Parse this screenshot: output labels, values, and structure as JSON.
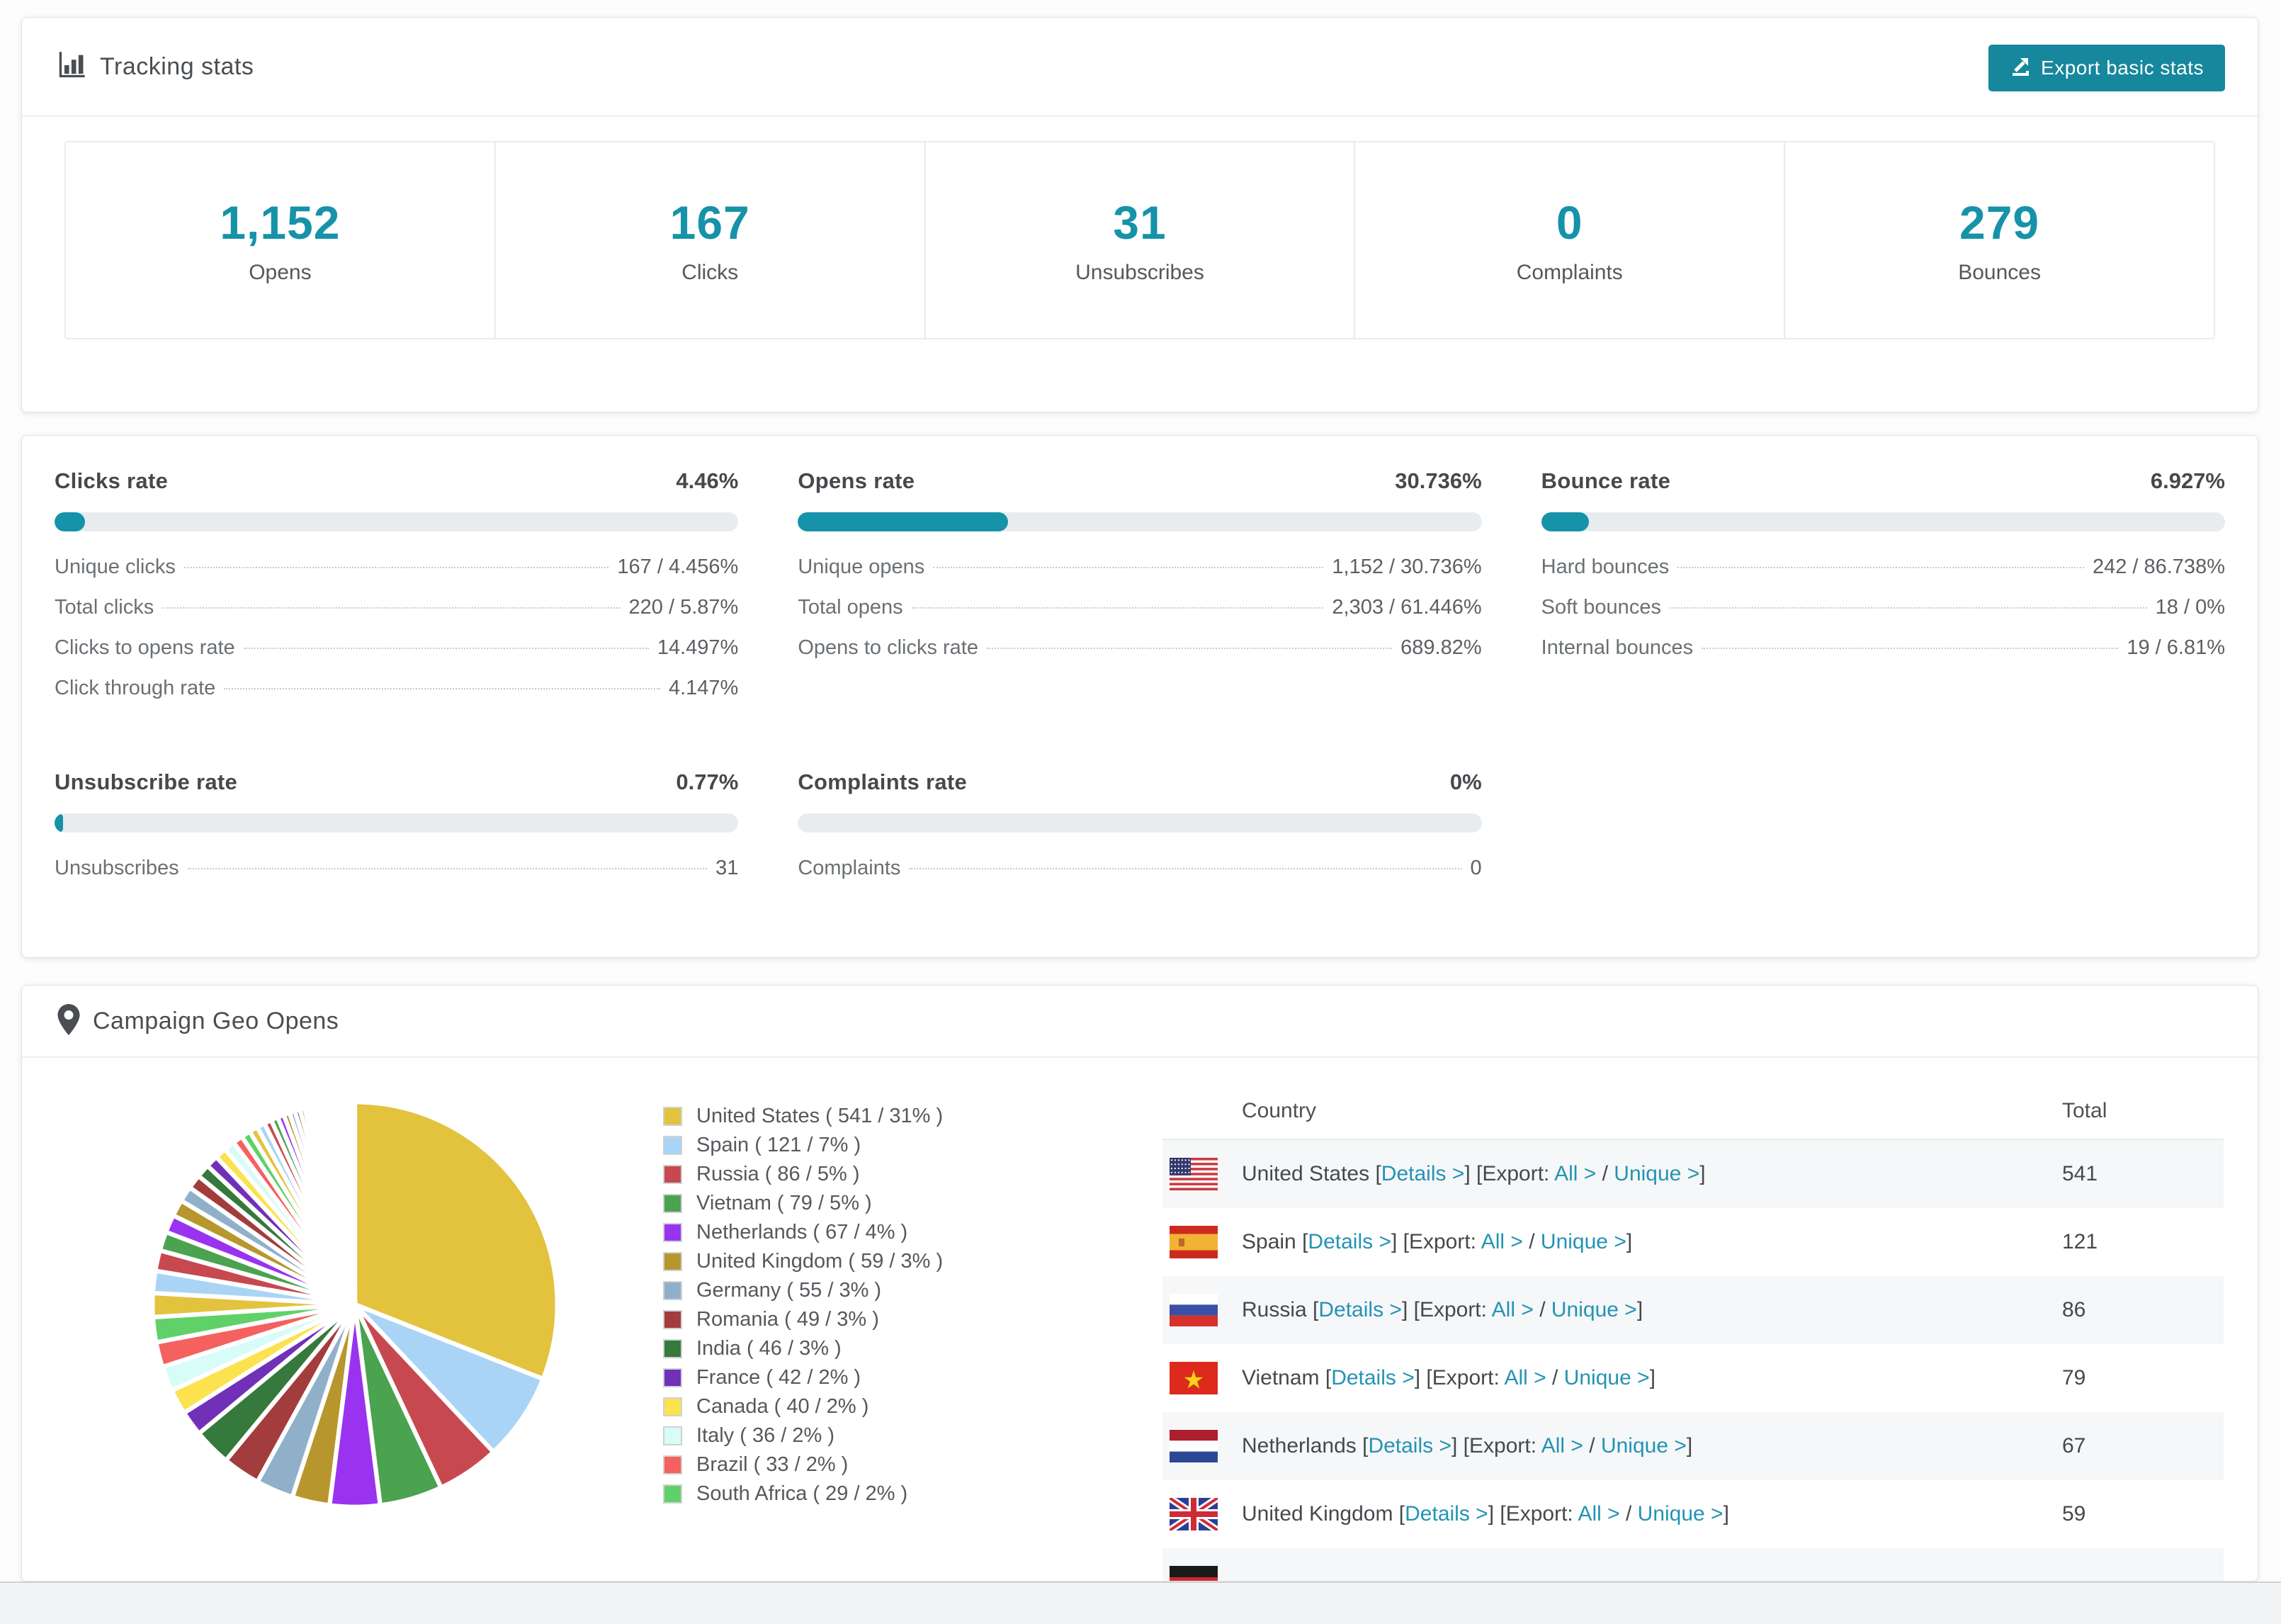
{
  "colors": {
    "accent": "#1692a9",
    "button": "#16879d",
    "link": "#2493b4",
    "bar_track": "#e9ecef",
    "row_stripe": "#f6f7f8"
  },
  "tracking_stats": {
    "title": "Tracking stats",
    "export_button_label": "Export basic stats",
    "summary": [
      {
        "value": "1,152",
        "label": "Opens"
      },
      {
        "value": "167",
        "label": "Clicks"
      },
      {
        "value": "31",
        "label": "Unsubscribes"
      },
      {
        "value": "0",
        "label": "Complaints"
      },
      {
        "value": "279",
        "label": "Bounces"
      }
    ]
  },
  "rate_panels": [
    {
      "title": "Clicks rate",
      "value": "4.46%",
      "pct": 4.46,
      "row_group": 1,
      "rows": [
        {
          "label": "Unique clicks",
          "value": "167 / 4.456%"
        },
        {
          "label": "Total clicks",
          "value": "220 / 5.87%"
        },
        {
          "label": "Clicks to opens rate",
          "value": "14.497%"
        },
        {
          "label": "Click through rate",
          "value": "4.147%"
        }
      ]
    },
    {
      "title": "Opens rate",
      "value": "30.736%",
      "pct": 30.736,
      "row_group": 1,
      "rows": [
        {
          "label": "Unique opens",
          "value": "1,152 / 30.736%"
        },
        {
          "label": "Total opens",
          "value": "2,303 / 61.446%"
        },
        {
          "label": "Opens to clicks rate",
          "value": "689.82%"
        }
      ]
    },
    {
      "title": "Bounce rate",
      "value": "6.927%",
      "pct": 6.927,
      "row_group": 1,
      "rows": [
        {
          "label": "Hard bounces",
          "value": "242 / 86.738%"
        },
        {
          "label": "Soft bounces",
          "value": "18 / 0%"
        },
        {
          "label": "Internal bounces",
          "value": "19 / 6.81%"
        }
      ]
    },
    {
      "title": "Unsubscribe rate",
      "value": "0.77%",
      "pct": 0.77,
      "row_group": 2,
      "rows": [
        {
          "label": "Unsubscribes",
          "value": "31"
        }
      ]
    },
    {
      "title": "Complaints rate",
      "value": "0%",
      "pct": 0,
      "row_group": 2,
      "rows": [
        {
          "label": "Complaints",
          "value": "0"
        }
      ]
    }
  ],
  "geo_opens": {
    "title": "Campaign Geo Opens",
    "table": {
      "columns": [
        "Country",
        "Total"
      ],
      "links": {
        "details_label": "Details >",
        "export_word": "Export:",
        "all_label": "All >",
        "separator": "/",
        "unique_label": "Unique >"
      },
      "rows": [
        {
          "flag": "us",
          "country": "United States",
          "total": "541"
        },
        {
          "flag": "es",
          "country": "Spain",
          "total": "121"
        },
        {
          "flag": "ru",
          "country": "Russia",
          "total": "86"
        },
        {
          "flag": "vn",
          "country": "Vietnam",
          "total": "79"
        },
        {
          "flag": "nl",
          "country": "Netherlands",
          "total": "67"
        },
        {
          "flag": "gb",
          "country": "United Kingdom",
          "total": "59"
        },
        {
          "flag": "de",
          "country": "",
          "total": ""
        }
      ]
    }
  },
  "chart_data": {
    "type": "pie",
    "title": "Campaign Geo Opens",
    "unit": "opens",
    "legend_position": "right",
    "legend_format": "{name} ( {count} / {percent}% )",
    "categories": [
      "United States",
      "Spain",
      "Russia",
      "Vietnam",
      "Netherlands",
      "United Kingdom",
      "Germany",
      "Romania",
      "India",
      "France",
      "Canada",
      "Italy",
      "Brazil",
      "South Africa"
    ],
    "values": [
      541,
      121,
      86,
      79,
      67,
      59,
      55,
      49,
      46,
      42,
      40,
      36,
      33,
      29
    ],
    "percents": [
      31,
      7,
      5,
      5,
      4,
      3,
      3,
      3,
      3,
      2,
      2,
      2,
      2,
      2
    ],
    "colors": [
      "#e3c23e",
      "#aad4f5",
      "#c7494f",
      "#4ba24f",
      "#9a33f0",
      "#b8962e",
      "#90b0ca",
      "#a33d3d",
      "#35793c",
      "#7030b8",
      "#fbe24e",
      "#d8fcf8",
      "#f4615e",
      "#60d168"
    ],
    "other_slices": {
      "total_percent": 26,
      "slice_count": 44,
      "decay": 0.93,
      "note": "many small unlabeled country slices"
    },
    "start_angle_deg": -90,
    "direction": "clockwise"
  }
}
